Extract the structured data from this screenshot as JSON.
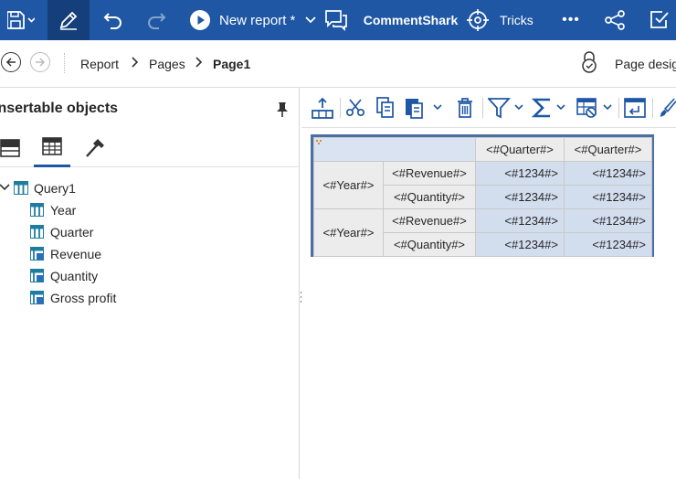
{
  "topbar": {
    "report_name": "New report *",
    "plugin": "CommentShark",
    "tricks": "Tricks",
    "more": "•••"
  },
  "breadcrumb": {
    "items": [
      "Report",
      "Pages",
      "Page1"
    ],
    "page_design": "Page design"
  },
  "left_panel": {
    "title": "Insertable objects",
    "query": "Query1",
    "items": [
      "Year",
      "Quarter",
      "Revenue",
      "Quantity",
      "Gross profit"
    ]
  },
  "crosstab": {
    "column_headers": [
      "<#Quarter#>",
      "<#Quarter#>"
    ],
    "rows": [
      {
        "row_header": "<#Year#>",
        "measures": [
          {
            "label": "<#Revenue#>",
            "values": [
              "<#1234#>",
              "<#1234#>"
            ]
          },
          {
            "label": "<#Quantity#>",
            "values": [
              "<#1234#>",
              "<#1234#>"
            ]
          }
        ]
      },
      {
        "row_header": "<#Year#>",
        "measures": [
          {
            "label": "<#Revenue#>",
            "values": [
              "<#1234#>",
              "<#1234#>"
            ]
          },
          {
            "label": "<#Quantity#>",
            "values": [
              "<#1234#>",
              "<#1234#>"
            ]
          }
        ]
      }
    ]
  },
  "colors": {
    "topbar": "#1f57a4",
    "topbar_active": "#153f7a",
    "accent": "#1f57a4",
    "cell_fill": "#d2ddee",
    "header_fill": "#ececec",
    "crosstab_border": "#4a6fa5"
  },
  "icons": {
    "save": "save-icon",
    "edit": "pencil-icon",
    "undo": "undo-icon",
    "redo": "redo-icon",
    "run": "play-icon",
    "comment": "comment-icon",
    "tricks": "crosshair-icon",
    "share": "share-icon",
    "lock": "lock-icon"
  }
}
